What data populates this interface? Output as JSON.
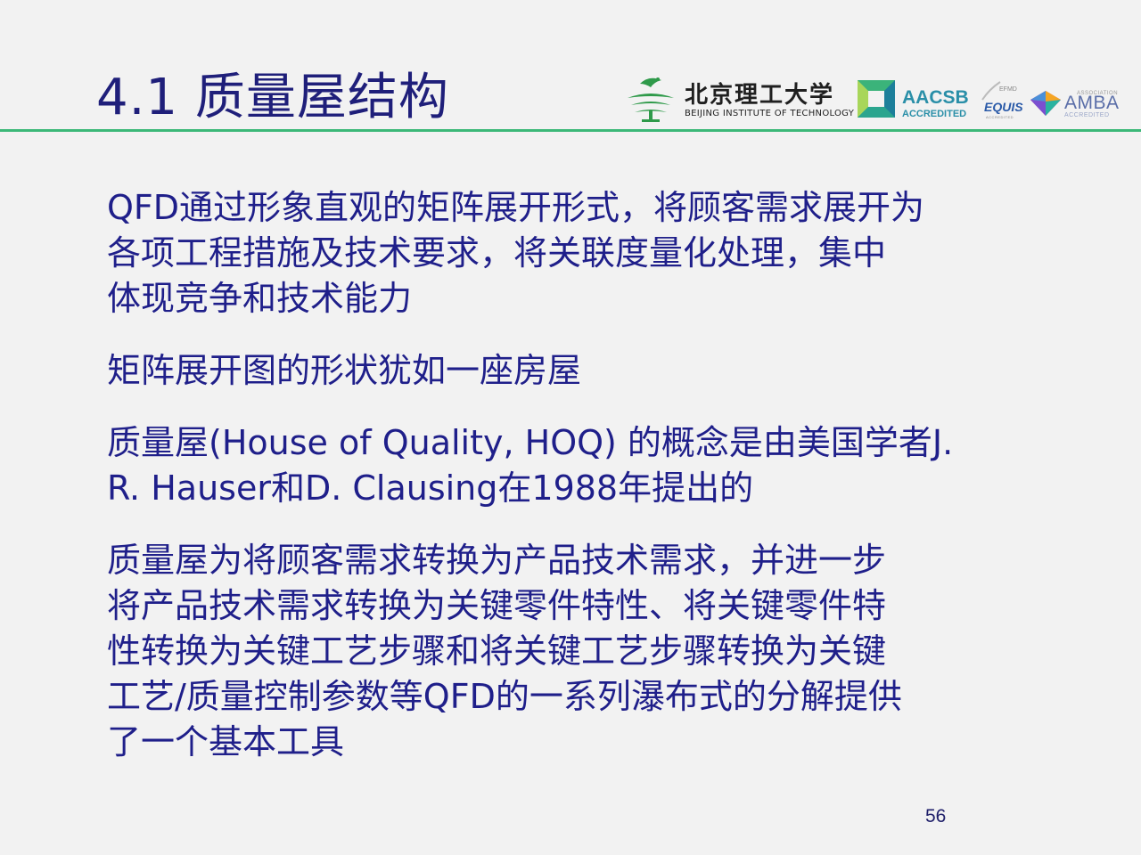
{
  "slide": {
    "title": "4.1 质量屋结构",
    "page_number": "56"
  },
  "logos": {
    "bit_cn": "北京理工大学",
    "bit_en": "BEIJING INSTITUTE OF TECHNOLOGY",
    "aacsb_name": "AACSB",
    "aacsb_accredited": "ACCREDITED",
    "efmd_label": "EFMD",
    "equis_name": "EQUIS",
    "equis_accredited": "ACCREDITED",
    "amba_association": "ASSOCIATION",
    "amba_name": "AMBA",
    "amba_accredited": "ACCREDITED"
  },
  "body": {
    "paragraphs": [
      {
        "lines": [
          "QFD通过形象直观的矩阵展开形式，将顾客需求展开为",
          "各项工程措施及技术要求，将关联度量化处理，集中",
          "体现竞争和技术能力"
        ]
      },
      {
        "lines": [
          "矩阵展开图的形状犹如一座房屋"
        ]
      },
      {
        "lines": [
          "质量屋(House of Quality, HOQ) 的概念是由美国学者J.",
          "R. Hauser和D. Clausing在1988年提出的"
        ]
      },
      {
        "lines": [
          "质量屋为将顾客需求转换为产品技术需求，并进一步",
          "将产品技术需求转换为关键零件特性、将关键零件特",
          "性转换为关键工艺步骤和将关键工艺步骤转换为关键",
          "工艺/质量控制参数等QFD的一系列瀑布式的分解提供",
          "了一个基本工具"
        ]
      }
    ]
  },
  "colors": {
    "title": "#1f1f7a",
    "body_text": "#1f1f8a",
    "header_rule": "#3cb878",
    "background": "#f2f2f2"
  }
}
